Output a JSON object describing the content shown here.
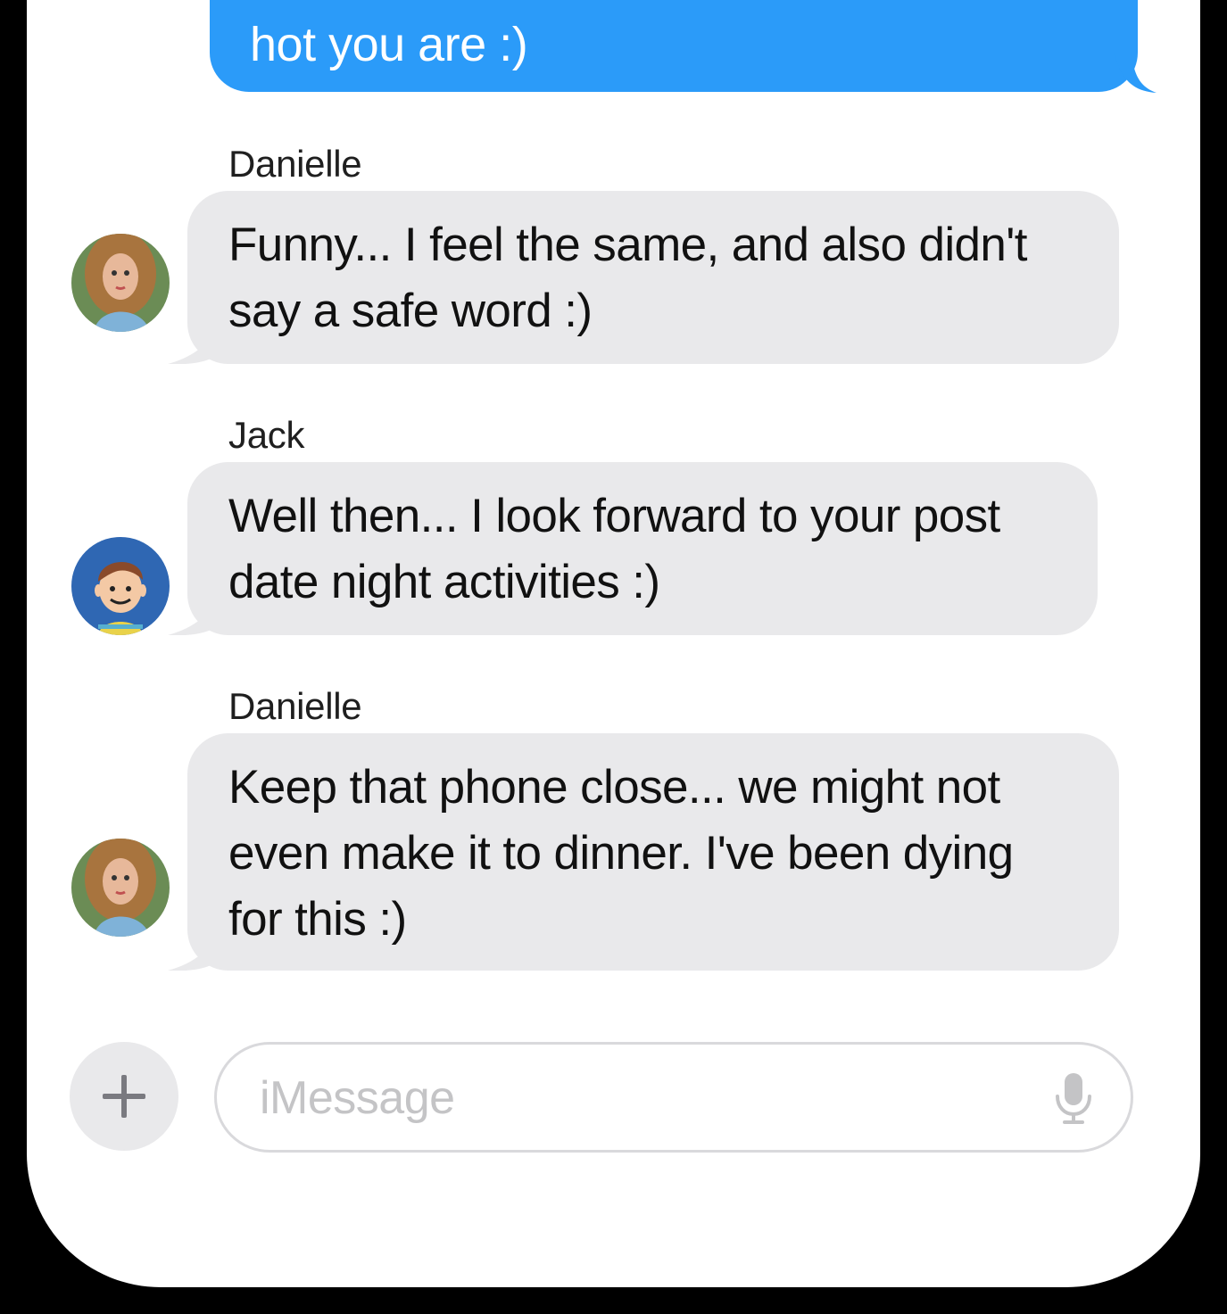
{
  "conversation": {
    "outgoing": {
      "text": "hot you are :)"
    },
    "messages": [
      {
        "sender": "Danielle",
        "text": "Funny... I feel the same, and also didn't\nsay a safe word :)"
      },
      {
        "sender": "Jack",
        "text": "Well then... I look forward to your post\ndate night activities :)"
      },
      {
        "sender": "Danielle",
        "text": "Keep that phone close... we might not\neven make it to dinner.  I've been dying\nfor this :)"
      }
    ]
  },
  "composer": {
    "placeholder": "iMessage",
    "add_icon": "plus-icon",
    "mic_icon": "microphone-icon"
  },
  "colors": {
    "outgoing_bubble": "#2b9bf9",
    "incoming_bubble": "#e9e9eb",
    "frame": "#000000"
  }
}
